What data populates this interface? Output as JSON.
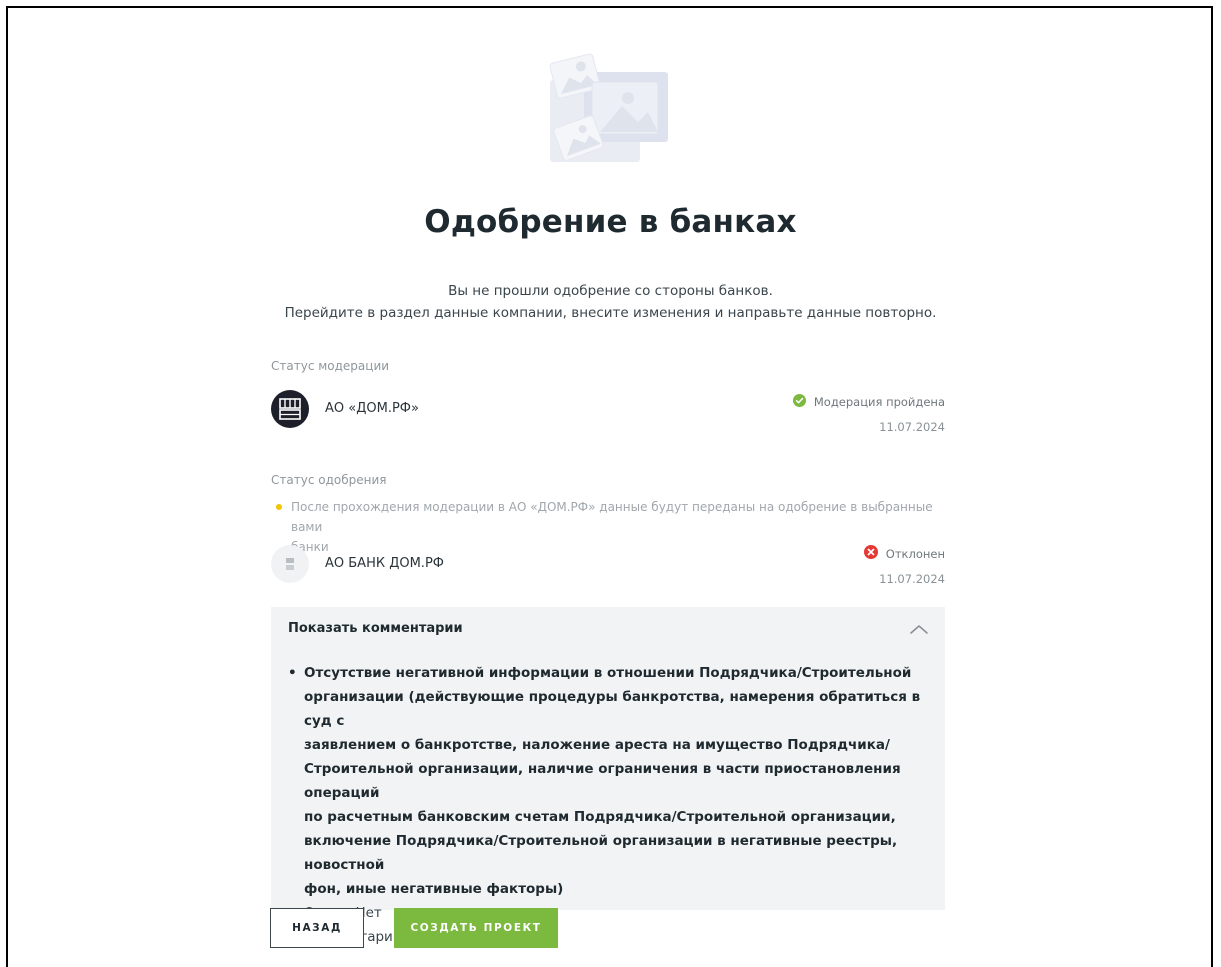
{
  "page": {
    "title": "Одобрение в банках",
    "subtitle_line1": "Вы не прошли одобрение со стороны банков.",
    "subtitle_line2": "Перейдите в раздел данные компании, внесите изменения и направьте данные повторно."
  },
  "moderation": {
    "label": "Статус модерации",
    "org_name": "АО «ДОМ.РФ»",
    "status": "Модерация пройдена",
    "date": "11.07.2024",
    "status_color": "#7cb93f"
  },
  "approval": {
    "label": "Статус одобрения",
    "note_line1": "После прохождения модерации в АО «ДОМ.РФ» данные будут переданы на одобрение в выбранные вами",
    "note_line2": "банки",
    "bank_name": "АО БАНК ДОМ.РФ",
    "status": "Отклонен",
    "date": "11.07.2024",
    "status_color": "#e53935"
  },
  "comments": {
    "toggle_label": "Показать комментарии",
    "items": [
      {
        "lines": [
          "Отсутствие негативной информации в отношении Подрядчика/Строительной",
          "организации (действующие процедуры банкротства, намерения обратиться в суд с",
          "заявлением о банкротстве, наложение ареста на имущество Подрядчика/",
          "Строительной организации, наличие ограничения в части приостановления операций",
          "по расчетным банковским счетам Подрядчика/Строительной организации,",
          "включение Подрядчика/Строительной организации в негативные реестры, новостной",
          "фон, иные негативные факторы)"
        ],
        "answer": "Ответ: Нет",
        "bank_comment": "Комментарий банка: 3"
      }
    ]
  },
  "actions": {
    "back_label": "НАЗАД",
    "create_label": "СОЗДАТЬ ПРОЕКТ",
    "create_color": "#7cb93f"
  },
  "icons": {
    "illustration": "images-placeholder-icon",
    "moderation_ok": "check-circle-icon",
    "rejected": "close-circle-icon",
    "toggle": "chevron-up-icon"
  }
}
